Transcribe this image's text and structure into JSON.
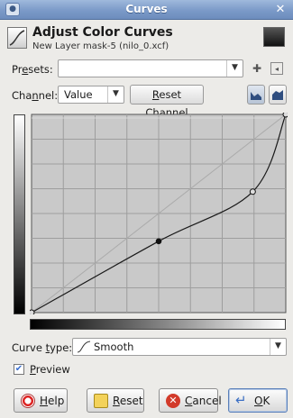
{
  "window": {
    "title": "Curves",
    "menu_icon": "gimp-eye-icon",
    "close_icon": "close-icon"
  },
  "header": {
    "title": "Adjust Color Curves",
    "subtitle": "New Layer mask-5 (nilo_0.xcf)"
  },
  "presets": {
    "label_pre": "Pr",
    "label_u": "e",
    "label_post": "sets:",
    "value": ""
  },
  "channel": {
    "label_pre": "Cha",
    "label_u": "n",
    "label_post": "nel:",
    "value": "Value",
    "reset_pre": "R",
    "reset_post": "eset Channel"
  },
  "curve_type": {
    "label_pre": "Curve ",
    "label_u": "t",
    "label_post": "ype:",
    "value": "Smooth"
  },
  "preview": {
    "label_u": "P",
    "label_post": "review",
    "checked": true
  },
  "buttons": {
    "help": {
      "u": "H",
      "rest": "elp"
    },
    "reset": {
      "u": "R",
      "rest": "eset"
    },
    "cancel": {
      "u": "C",
      "rest": "ancel"
    },
    "ok": {
      "u": "O",
      "rest": "K"
    }
  },
  "curve": {
    "points": [
      [
        0,
        0
      ],
      [
        0.5,
        0.36
      ],
      [
        0.87,
        0.61
      ],
      [
        1,
        1
      ]
    ]
  }
}
